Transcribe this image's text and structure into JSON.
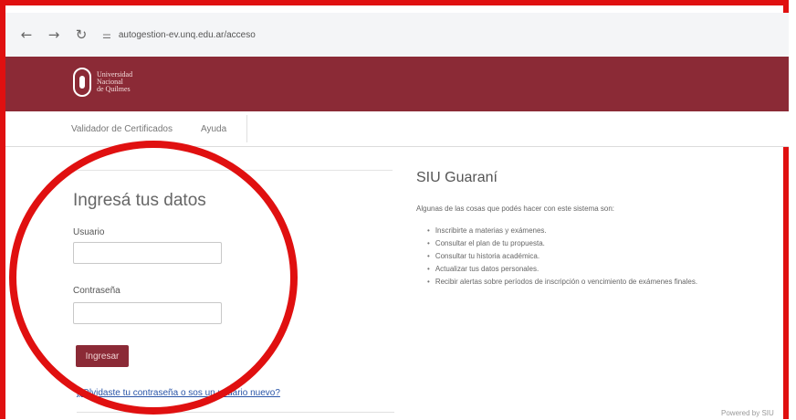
{
  "browser": {
    "back_icon": "←",
    "forward_icon": "→",
    "reload_icon": "↻",
    "site_settings_icon": "⚌",
    "url": "autogestion-ev.unq.edu.ar/acceso"
  },
  "header": {
    "logo_line1": "Universidad",
    "logo_line2": "Nacional",
    "logo_line3": "de Quilmes"
  },
  "menu": {
    "item1": "Validador de Certificados",
    "item2": "Ayuda"
  },
  "login": {
    "title": "Ingresá tus datos",
    "user_label": "Usuario",
    "password_label": "Contraseña",
    "submit_label": "Ingresar",
    "forgot_link": "¿Olvidaste tu contraseña o sos un usuario nuevo?"
  },
  "info": {
    "title": "SIU Guaraní",
    "intro": "Algunas de las cosas que podés hacer con este sistema son:",
    "features": [
      "Inscribirte a materias y exámenes.",
      "Consultar el plan de tu propuesta.",
      "Consultar tu historia académica.",
      "Actualizar tus datos personales.",
      "Recibir alertas sobre períodos de inscripción o vencimiento de exámenes finales."
    ]
  },
  "footer": {
    "right_text": "Powered by SIU"
  },
  "colors": {
    "brand": "#8b2a36",
    "annotation": "#e01010"
  }
}
